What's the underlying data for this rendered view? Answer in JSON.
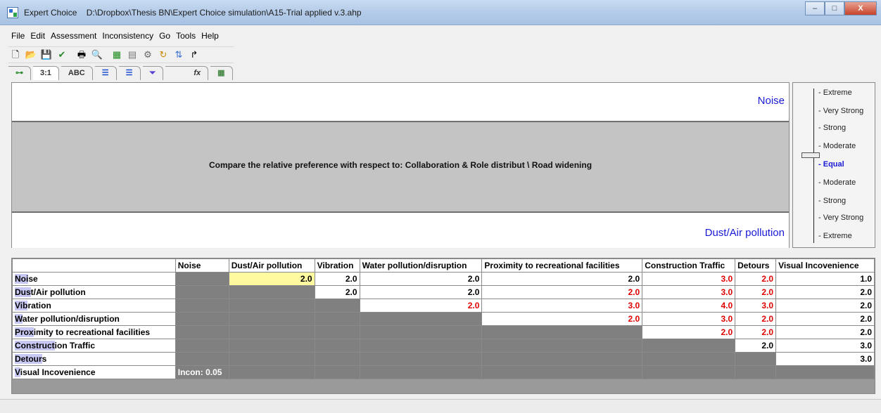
{
  "window": {
    "app_name": "Expert Choice",
    "file_path": "D:\\Dropbox\\Thesis BN\\Expert Choice simulation\\A15-Trial applied v.3.ahp",
    "minimize": "–",
    "maximize": "□",
    "close": "X"
  },
  "menu": [
    "File",
    "Edit",
    "Assessment",
    "Inconsistency",
    "Go",
    "Tools",
    "Help"
  ],
  "toolbar_icons": [
    "new-file-icon",
    "open-folder-icon",
    "save-icon",
    "checkmark-icon",
    "print-icon",
    "print-preview-icon",
    "calculator-icon",
    "calendar-icon",
    "network-icon",
    "refresh-icon",
    "sort-icon"
  ],
  "tabs": [
    "",
    "3:1",
    "ABC",
    "",
    "",
    "",
    "fx",
    ""
  ],
  "compare": {
    "top_element": "Noise",
    "bottom_element": "Dust/Air pollution",
    "prompt": "Compare the relative preference with respect to: Collaboration & Role distribut \\ Road widening"
  },
  "scale": {
    "labels": [
      "Extreme",
      "Very Strong",
      "Strong",
      "Moderate",
      "Equal",
      "Moderate",
      "Strong",
      "Very Strong",
      "Extreme"
    ],
    "selected_index": 4
  },
  "matrix": {
    "columns": [
      "Noise",
      "Dust/Air pollution",
      "Vibration",
      "Water pollution/disruption",
      "Proximity to recreational facilities",
      "Construction Traffic",
      "Detours",
      "Visual Incovenience"
    ],
    "rows": [
      {
        "name": "Noise",
        "highlight": "Noi",
        "rest": "se",
        "cells": [
          "",
          "2.0",
          "2.0",
          "2.0",
          "2.0",
          "3.0",
          "2.0",
          "1.0"
        ],
        "red": [
          false,
          false,
          false,
          false,
          false,
          true,
          true,
          false
        ]
      },
      {
        "name": "Dust/Air pollution",
        "highlight": "Dus",
        "rest": "t/Air pollution",
        "cells": [
          "",
          "",
          "2.0",
          "2.0",
          "2.0",
          "3.0",
          "2.0",
          "2.0"
        ],
        "red": [
          false,
          false,
          false,
          false,
          true,
          true,
          true,
          false
        ]
      },
      {
        "name": "Vibration",
        "highlight": "Vib",
        "rest": "ration",
        "cells": [
          "",
          "",
          "",
          "2.0",
          "3.0",
          "4.0",
          "3.0",
          "2.0"
        ],
        "red": [
          false,
          false,
          false,
          true,
          true,
          true,
          true,
          false
        ]
      },
      {
        "name": "Water pollution/disruption",
        "highlight": "W",
        "rest": "ater pollution/disruption",
        "cells": [
          "",
          "",
          "",
          "",
          "2.0",
          "3.0",
          "2.0",
          "2.0"
        ],
        "red": [
          false,
          false,
          false,
          false,
          true,
          true,
          true,
          false
        ]
      },
      {
        "name": "Proximity to recreational facilities",
        "highlight": "Prox",
        "rest": "imity to recreational facilities",
        "cells": [
          "",
          "",
          "",
          "",
          "",
          "2.0",
          "2.0",
          "2.0"
        ],
        "red": [
          false,
          false,
          false,
          false,
          false,
          true,
          true,
          false
        ]
      },
      {
        "name": "Construction Traffic",
        "highlight": "Construct",
        "rest": "ion Traffic",
        "cells": [
          "",
          "",
          "",
          "",
          "",
          "",
          "2.0",
          "3.0"
        ],
        "red": [
          false,
          false,
          false,
          false,
          false,
          false,
          false,
          false
        ]
      },
      {
        "name": "Detours",
        "highlight": "Detour",
        "rest": "s",
        "cells": [
          "",
          "",
          "",
          "",
          "",
          "",
          "",
          "3.0"
        ],
        "red": [
          false,
          false,
          false,
          false,
          false,
          false,
          false,
          false
        ]
      },
      {
        "name": "Visual Incovenience",
        "highlight": "V",
        "rest": "isual Incovenience",
        "cells": [
          "",
          "",
          "",
          "",
          "",
          "",
          "",
          ""
        ],
        "red": [
          false,
          false,
          false,
          false,
          false,
          false,
          false,
          false
        ]
      }
    ],
    "inconsistency": "Incon: 0.05"
  }
}
